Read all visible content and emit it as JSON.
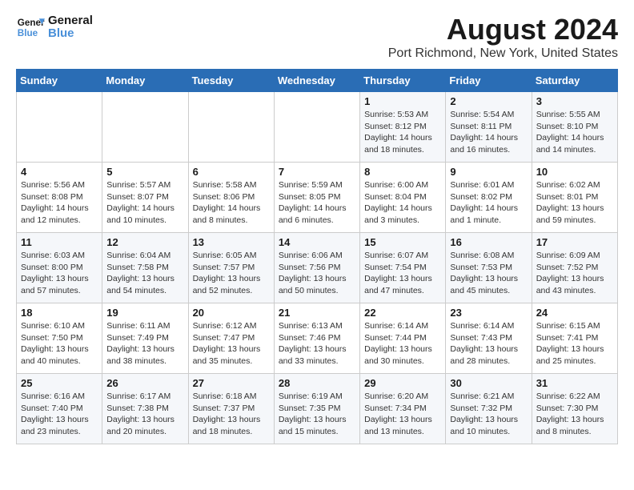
{
  "logo": {
    "line1": "General",
    "line2": "Blue"
  },
  "title": "August 2024",
  "subtitle": "Port Richmond, New York, United States",
  "weekdays": [
    "Sunday",
    "Monday",
    "Tuesday",
    "Wednesday",
    "Thursday",
    "Friday",
    "Saturday"
  ],
  "weeks": [
    [
      {
        "day": "",
        "info": ""
      },
      {
        "day": "",
        "info": ""
      },
      {
        "day": "",
        "info": ""
      },
      {
        "day": "",
        "info": ""
      },
      {
        "day": "1",
        "info": "Sunrise: 5:53 AM\nSunset: 8:12 PM\nDaylight: 14 hours\nand 18 minutes."
      },
      {
        "day": "2",
        "info": "Sunrise: 5:54 AM\nSunset: 8:11 PM\nDaylight: 14 hours\nand 16 minutes."
      },
      {
        "day": "3",
        "info": "Sunrise: 5:55 AM\nSunset: 8:10 PM\nDaylight: 14 hours\nand 14 minutes."
      }
    ],
    [
      {
        "day": "4",
        "info": "Sunrise: 5:56 AM\nSunset: 8:08 PM\nDaylight: 14 hours\nand 12 minutes."
      },
      {
        "day": "5",
        "info": "Sunrise: 5:57 AM\nSunset: 8:07 PM\nDaylight: 14 hours\nand 10 minutes."
      },
      {
        "day": "6",
        "info": "Sunrise: 5:58 AM\nSunset: 8:06 PM\nDaylight: 14 hours\nand 8 minutes."
      },
      {
        "day": "7",
        "info": "Sunrise: 5:59 AM\nSunset: 8:05 PM\nDaylight: 14 hours\nand 6 minutes."
      },
      {
        "day": "8",
        "info": "Sunrise: 6:00 AM\nSunset: 8:04 PM\nDaylight: 14 hours\nand 3 minutes."
      },
      {
        "day": "9",
        "info": "Sunrise: 6:01 AM\nSunset: 8:02 PM\nDaylight: 14 hours\nand 1 minute."
      },
      {
        "day": "10",
        "info": "Sunrise: 6:02 AM\nSunset: 8:01 PM\nDaylight: 13 hours\nand 59 minutes."
      }
    ],
    [
      {
        "day": "11",
        "info": "Sunrise: 6:03 AM\nSunset: 8:00 PM\nDaylight: 13 hours\nand 57 minutes."
      },
      {
        "day": "12",
        "info": "Sunrise: 6:04 AM\nSunset: 7:58 PM\nDaylight: 13 hours\nand 54 minutes."
      },
      {
        "day": "13",
        "info": "Sunrise: 6:05 AM\nSunset: 7:57 PM\nDaylight: 13 hours\nand 52 minutes."
      },
      {
        "day": "14",
        "info": "Sunrise: 6:06 AM\nSunset: 7:56 PM\nDaylight: 13 hours\nand 50 minutes."
      },
      {
        "day": "15",
        "info": "Sunrise: 6:07 AM\nSunset: 7:54 PM\nDaylight: 13 hours\nand 47 minutes."
      },
      {
        "day": "16",
        "info": "Sunrise: 6:08 AM\nSunset: 7:53 PM\nDaylight: 13 hours\nand 45 minutes."
      },
      {
        "day": "17",
        "info": "Sunrise: 6:09 AM\nSunset: 7:52 PM\nDaylight: 13 hours\nand 43 minutes."
      }
    ],
    [
      {
        "day": "18",
        "info": "Sunrise: 6:10 AM\nSunset: 7:50 PM\nDaylight: 13 hours\nand 40 minutes."
      },
      {
        "day": "19",
        "info": "Sunrise: 6:11 AM\nSunset: 7:49 PM\nDaylight: 13 hours\nand 38 minutes."
      },
      {
        "day": "20",
        "info": "Sunrise: 6:12 AM\nSunset: 7:47 PM\nDaylight: 13 hours\nand 35 minutes."
      },
      {
        "day": "21",
        "info": "Sunrise: 6:13 AM\nSunset: 7:46 PM\nDaylight: 13 hours\nand 33 minutes."
      },
      {
        "day": "22",
        "info": "Sunrise: 6:14 AM\nSunset: 7:44 PM\nDaylight: 13 hours\nand 30 minutes."
      },
      {
        "day": "23",
        "info": "Sunrise: 6:14 AM\nSunset: 7:43 PM\nDaylight: 13 hours\nand 28 minutes."
      },
      {
        "day": "24",
        "info": "Sunrise: 6:15 AM\nSunset: 7:41 PM\nDaylight: 13 hours\nand 25 minutes."
      }
    ],
    [
      {
        "day": "25",
        "info": "Sunrise: 6:16 AM\nSunset: 7:40 PM\nDaylight: 13 hours\nand 23 minutes."
      },
      {
        "day": "26",
        "info": "Sunrise: 6:17 AM\nSunset: 7:38 PM\nDaylight: 13 hours\nand 20 minutes."
      },
      {
        "day": "27",
        "info": "Sunrise: 6:18 AM\nSunset: 7:37 PM\nDaylight: 13 hours\nand 18 minutes."
      },
      {
        "day": "28",
        "info": "Sunrise: 6:19 AM\nSunset: 7:35 PM\nDaylight: 13 hours\nand 15 minutes."
      },
      {
        "day": "29",
        "info": "Sunrise: 6:20 AM\nSunset: 7:34 PM\nDaylight: 13 hours\nand 13 minutes."
      },
      {
        "day": "30",
        "info": "Sunrise: 6:21 AM\nSunset: 7:32 PM\nDaylight: 13 hours\nand 10 minutes."
      },
      {
        "day": "31",
        "info": "Sunrise: 6:22 AM\nSunset: 7:30 PM\nDaylight: 13 hours\nand 8 minutes."
      }
    ]
  ]
}
